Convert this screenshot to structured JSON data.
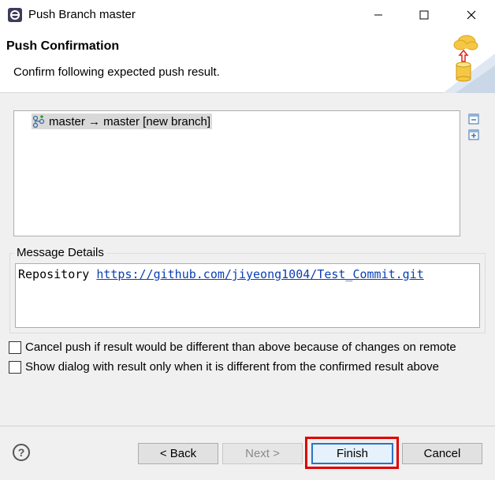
{
  "window": {
    "title": "Push Branch master",
    "app_icon": "eclipse-icon",
    "controls": [
      "minimize-icon",
      "maximize-icon",
      "close-icon"
    ]
  },
  "header": {
    "title": "Push Confirmation",
    "subtitle": "Confirm following expected push result.",
    "graphic": "cloud-push-database-icon"
  },
  "results": {
    "rows": [
      {
        "icon": "branch-icon",
        "label": "master → master [new branch]"
      }
    ],
    "side_buttons": [
      "collapse-all-icon",
      "expand-all-icon"
    ]
  },
  "message_details": {
    "label": "Message Details",
    "repo_prefix": "Repository ",
    "repo_url": "https://github.com/jiyeong1004/Test_Commit.git"
  },
  "options": {
    "cancel_if_different": "Cancel push if result would be different than above because of changes on remote",
    "show_dialog_only_if_different": "Show dialog with result only when it is different from the confirmed result above"
  },
  "buttons": {
    "help": "?",
    "back": "< Back",
    "next": "Next >",
    "finish": "Finish",
    "cancel": "Cancel"
  },
  "colors": {
    "highlight": "#e00000",
    "link": "#0a3fb5",
    "default_button_border": "#2a73c8"
  }
}
